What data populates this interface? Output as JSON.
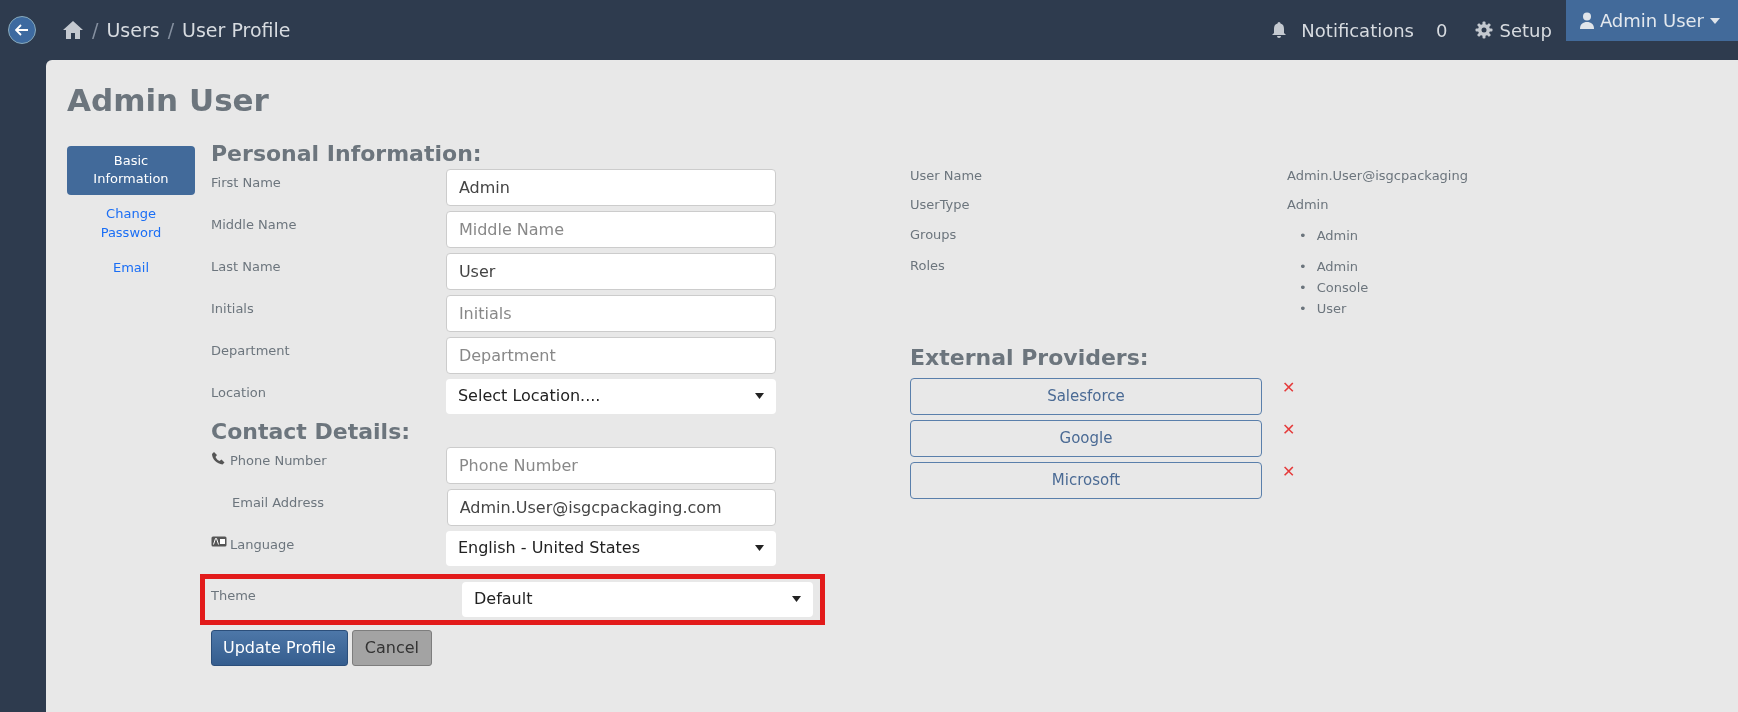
{
  "topbar": {
    "breadcrumb": [
      {
        "separator": "/",
        "label": "Users"
      },
      {
        "separator": "/",
        "label": "User Profile"
      }
    ],
    "notifications_label": "Notifications",
    "notifications_count": "0",
    "setup_label": "Setup",
    "user_menu": "Admin User"
  },
  "page_title": "Admin User",
  "side_nav": [
    {
      "label": "Basic Information",
      "selected": true
    },
    {
      "label": "Change Password",
      "selected": false
    },
    {
      "label": "Email",
      "selected": false
    }
  ],
  "sections": [
    {
      "heading": "Personal Information:",
      "fields": [
        {
          "label": "First Name",
          "kind": "text",
          "value": "Admin"
        },
        {
          "label": "Middle Name",
          "kind": "text",
          "placeholder": "Middle Name"
        },
        {
          "label": "Last Name",
          "kind": "text",
          "value": "User"
        },
        {
          "label": "Initials",
          "kind": "text",
          "placeholder": "Initials"
        },
        {
          "label": "Department",
          "kind": "text",
          "placeholder": "Department"
        },
        {
          "label": "Location",
          "kind": "select",
          "value": "Select Location...."
        }
      ]
    },
    {
      "heading": "Contact Details:",
      "fields": [
        {
          "label": "Phone Number",
          "kind": "phone",
          "placeholder": "Phone Number"
        },
        {
          "label": "Email Address",
          "kind": "email",
          "value": "Admin.User@isgcpackaging.com"
        },
        {
          "label": "Language",
          "kind": "language",
          "value": "English - United States"
        },
        {
          "label": "Theme",
          "kind": "select",
          "value": "Default",
          "highlighted": true
        }
      ]
    }
  ],
  "buttons": [
    {
      "label": "Update Profile",
      "kind": "primary"
    },
    {
      "label": "Cancel",
      "kind": "secondary"
    }
  ],
  "user_info": [
    {
      "label": "User Name",
      "value": "Admin.User@isgcpackaging"
    },
    {
      "label": "UserType",
      "value": "Admin"
    },
    {
      "label": "Groups",
      "items": [
        {
          "bullet": "•",
          "text": "Admin"
        }
      ]
    },
    {
      "label": "Roles",
      "items": [
        {
          "bullet": "•",
          "text": "Admin"
        },
        {
          "bullet": "•",
          "text": "Console"
        },
        {
          "bullet": "•",
          "text": "User"
        }
      ]
    }
  ],
  "external_providers": {
    "heading": "External Providers:",
    "providers": [
      {
        "name": "Salesforce",
        "remove": "✕"
      },
      {
        "name": "Google",
        "remove": "✕"
      },
      {
        "name": "Microsoft",
        "remove": "✕"
      }
    ]
  }
}
